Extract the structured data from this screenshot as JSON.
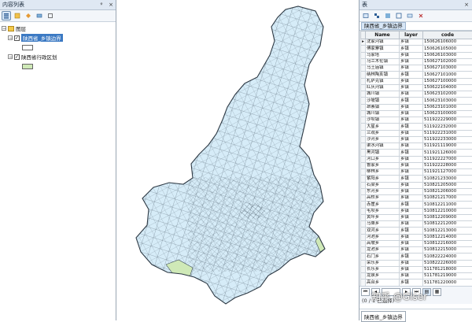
{
  "toc": {
    "title": "内容列表",
    "pin_symbol": "ᵠ",
    "close_symbol": "×",
    "root_label": "图层",
    "layers": [
      {
        "name": "陕西省_乡镇边界",
        "selected": true,
        "checked": true,
        "swatch_color": "#ffffff"
      },
      {
        "name": "陕西省行政区划",
        "selected": false,
        "checked": true,
        "swatch_color": "#cfe9b7"
      }
    ]
  },
  "table": {
    "title": "表",
    "close_symbol": "×",
    "layer_tab": "陕西省_乡镇边界",
    "columns": [
      "Name",
      "layer",
      "code"
    ],
    "rows": [
      [
        "沈家河镇",
        "乡镇",
        "150626106000"
      ],
      [
        "傅家寨镇",
        "乡镇",
        "150626105000"
      ],
      [
        "马家塔",
        "乡镇",
        "150626103000"
      ],
      [
        "乌兰木伦镇",
        "乡镇",
        "150627102000"
      ],
      [
        "马王庙镇",
        "乡镇",
        "150627103000"
      ],
      [
        "纳林陶亥镇",
        "乡镇",
        "150627101000"
      ],
      [
        "札萨克镇",
        "乡镇",
        "150627100000"
      ],
      [
        "红庆河镇",
        "乡镇",
        "150622104000"
      ],
      [
        "城川镇",
        "乡镇",
        "150623102000"
      ],
      [
        "沙坡镇",
        "乡镇",
        "150623103000"
      ],
      [
        "昂素镇",
        "乡镇",
        "150623101000"
      ],
      [
        "城川镇",
        "乡镇",
        "150623100000"
      ],
      [
        "沙坝镇",
        "乡镇",
        "511922229000"
      ],
      [
        "大星乡",
        "乡镇",
        "511922232000"
      ],
      [
        "兰观乡",
        "乡镇",
        "511922231000"
      ],
      [
        "沙河乡",
        "乡镇",
        "511922233000"
      ],
      [
        "渠水河镇",
        "乡镇",
        "511921119000"
      ],
      [
        "黑河镇",
        "乡镇",
        "511921126000"
      ],
      [
        "河口乡",
        "乡镇",
        "511922227000"
      ],
      [
        "鲁家乡",
        "乡镇",
        "511922228000"
      ],
      [
        "柳林乡",
        "乡镇",
        "511921127000"
      ],
      [
        "紫阳乡",
        "乡镇",
        "510821233000"
      ],
      [
        "石梁乡",
        "乡镇",
        "510821205000"
      ],
      [
        "东河乡",
        "乡镇",
        "510821206000"
      ],
      [
        "高桥乡",
        "乡镇",
        "510821217000"
      ],
      [
        "赤崖乡",
        "乡镇",
        "510812211000"
      ],
      [
        "毛坝乡",
        "乡镇",
        "510812210000"
      ],
      [
        "黄坪乡",
        "乡镇",
        "510812209000"
      ],
      [
        "马桑乡",
        "乡镇",
        "510812212000"
      ],
      [
        "双河乡",
        "乡镇",
        "510812213000"
      ],
      [
        "河池乡",
        "乡镇",
        "510812214000"
      ],
      [
        "高坡乡",
        "乡镇",
        "510812216000"
      ],
      [
        "龙池乡",
        "乡镇",
        "510812215000"
      ],
      [
        "石门乡",
        "乡镇",
        "510822224000"
      ],
      [
        "荣乐乡",
        "乡镇",
        "510822226000"
      ],
      [
        "长乐乡",
        "乡镇",
        "511781218000"
      ],
      [
        "龙泉乡",
        "乡镇",
        "511781219000"
      ],
      [
        "高台乡",
        "乡镇",
        "511781220000"
      ],
      [
        "大竹乡",
        "乡镇",
        "511781222000"
      ],
      [
        "石桥乡",
        "乡镇",
        "511781223000"
      ]
    ],
    "status_text": "(0 / 1 已选择)",
    "watermark": "知乎 @Giser"
  },
  "map": {
    "province_fill": "#d6ecf8",
    "border_color": "#3c4a57",
    "highlight_fill": "#cfe9b7"
  }
}
